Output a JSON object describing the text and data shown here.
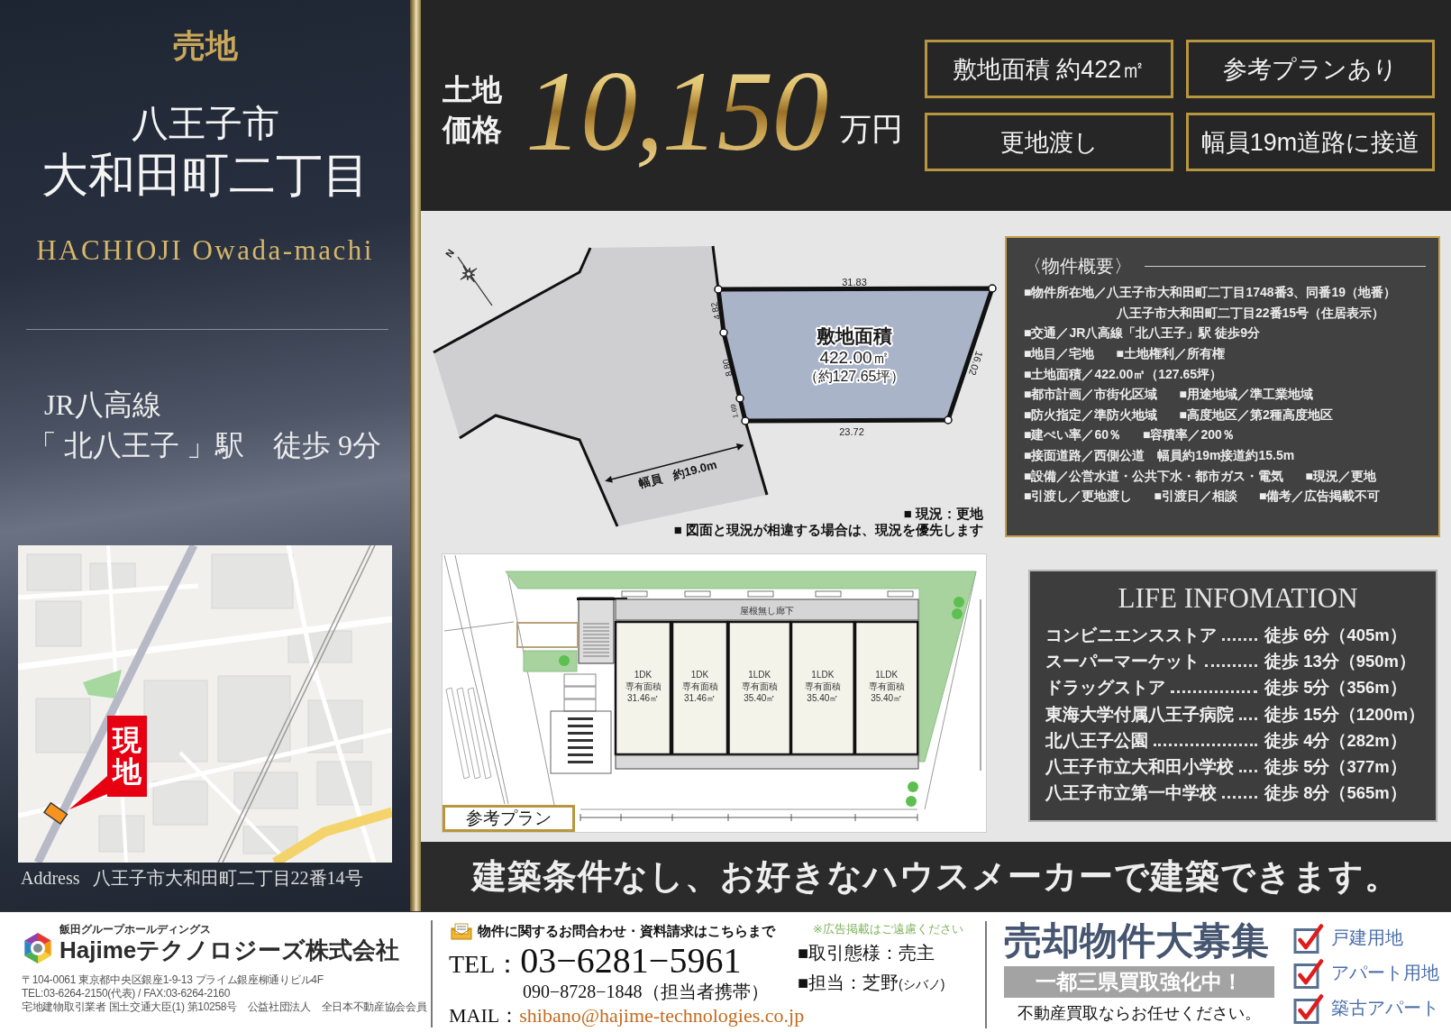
{
  "left_panel": {
    "category": "売地",
    "city": "八王子市",
    "town": "大和田町二丁目",
    "romaji": "HACHIOJI Owada-machi",
    "line": "JR八高線",
    "station": "「 北八王子 」駅　徒歩 9分",
    "site_label": "現地",
    "address_label": "Address",
    "address": "八王子市大和田町二丁目22番14号"
  },
  "header": {
    "price_label": [
      "土地",
      "価格"
    ],
    "price": "10,150",
    "unit": "万円",
    "features": [
      "敷地面積 約422㎡",
      "参考プランあり",
      "更地渡し",
      "幅員19m道路に接道"
    ]
  },
  "site_plan": {
    "north": "N",
    "edge_lengths": [
      "31.83",
      "4.82",
      "8.80",
      "1.69",
      "16.02",
      "23.72"
    ],
    "area_title": "敷地面積",
    "area": "422.00㎡",
    "area_tsubo": "（約127.65坪）",
    "road_width": "幅員　約19.0m",
    "notes": [
      "■ 現況：更地",
      "■ 図面と現況が相違する場合は、現況を優先します"
    ]
  },
  "floor_plan": {
    "corridor": "屋根無し廊下",
    "units": [
      {
        "type": "1DK",
        "label": "専有面積",
        "area": "31.46㎡"
      },
      {
        "type": "1DK",
        "label": "専有面積",
        "area": "31.46㎡"
      },
      {
        "type": "1LDK",
        "label": "専有面積",
        "area": "35.40㎡"
      },
      {
        "type": "1LDK",
        "label": "専有面積",
        "area": "35.40㎡"
      },
      {
        "type": "1LDK",
        "label": "専有面積",
        "area": "35.40㎡"
      }
    ],
    "label": "参考プラン"
  },
  "summary": {
    "title": "〈物件概要〉",
    "rows": [
      {
        "kind": "item",
        "cells": [
          "■物件所在地／八王子市大和田町二丁目1748番3、同番19（地番）"
        ]
      },
      {
        "kind": "continuation",
        "cells": [
          "八王子市大和田町二丁目22番15号（住居表示）"
        ]
      },
      {
        "kind": "item",
        "cells": [
          "■交通／JR八高線「北八王子」駅 徒歩9分"
        ]
      },
      {
        "kind": "item",
        "cells": [
          "■地目／宅地",
          "■土地権利／所有権"
        ]
      },
      {
        "kind": "item",
        "cells": [
          "■土地面積／422.00㎡（127.65坪）"
        ]
      },
      {
        "kind": "item",
        "cells": [
          "■都市計画／市街化区域",
          "■用途地域／準工業地域"
        ]
      },
      {
        "kind": "item",
        "cells": [
          "■防火指定／準防火地域",
          "■高度地区／第2種高度地区"
        ]
      },
      {
        "kind": "item",
        "cells": [
          "■建ぺい率／60％",
          "■容積率／200％"
        ]
      },
      {
        "kind": "item",
        "cells": [
          "■接面道路／西側公道　幅員約19m接道約15.5m"
        ]
      },
      {
        "kind": "item",
        "cells": [
          "■設備／公営水道・公共下水・都市ガス・電気",
          "■現況／更地"
        ]
      },
      {
        "kind": "item",
        "cells": [
          "■引渡し／更地渡し",
          "■引渡日／相談",
          "■備考／広告掲載不可"
        ]
      }
    ]
  },
  "life_info": {
    "title": "LIFE INFOMATION",
    "items": [
      {
        "place": "コンビニエンスストア",
        "access": "徒歩 6分（405m）"
      },
      {
        "place": "スーパーマーケット",
        "access": "徒歩 13分（950m）"
      },
      {
        "place": "ドラッグストア",
        "access": "徒歩 5分（356m）"
      },
      {
        "place": "東海大学付属八王子病院",
        "access": "徒歩 15分（1200m）"
      },
      {
        "place": "北八王子公園",
        "access": "徒歩 4分（282m）"
      },
      {
        "place": "八王子市立大和田小学校",
        "access": "徒歩 5分（377m）"
      },
      {
        "place": "八王子市立第一中学校",
        "access": "徒歩 8分（565m）"
      }
    ]
  },
  "banner": "建築条件なし、お好きなハウスメーカーで建築できます。",
  "footer": {
    "company": {
      "group": "飯田グループホールディングス",
      "name": "Hajimeテクノロジーズ株式会社",
      "address_lines": [
        "〒104-0061 東京都中央区銀座1-9-13 プライム銀座柳通りビル4F",
        "TEL:03-6264-2150(代表) / FAX:03-6264-2160",
        "宅地建物取引業者 国土交通大臣(1) 第10258号　公益社団法人　全日本不動産協会会員"
      ]
    },
    "contact": {
      "heading": "物件に関するお問合わせ・資料請求はこちらまで",
      "tel_label": "TEL：",
      "tel": "03−6281−5961",
      "mobile": "090−8728−1848（担当者携帯）",
      "mail_label": "MAIL：",
      "mail": "shibano@hajime-technologies.co.jp",
      "notice": "※広告掲載はご遠慮ください",
      "deal": "■取引態様：売主",
      "person": "■担当：芝野",
      "person_reading": "(シバノ)"
    },
    "buying": {
      "title": "売却物件大募集",
      "banner": "一都三県買取強化中！",
      "tagline": "不動産買取ならお任せください。",
      "checklist": [
        {
          "label": "戸建用地",
          "checked": true
        },
        {
          "label": "アパート用地",
          "checked": true
        },
        {
          "label": "築古アパート",
          "checked": true
        }
      ]
    }
  }
}
